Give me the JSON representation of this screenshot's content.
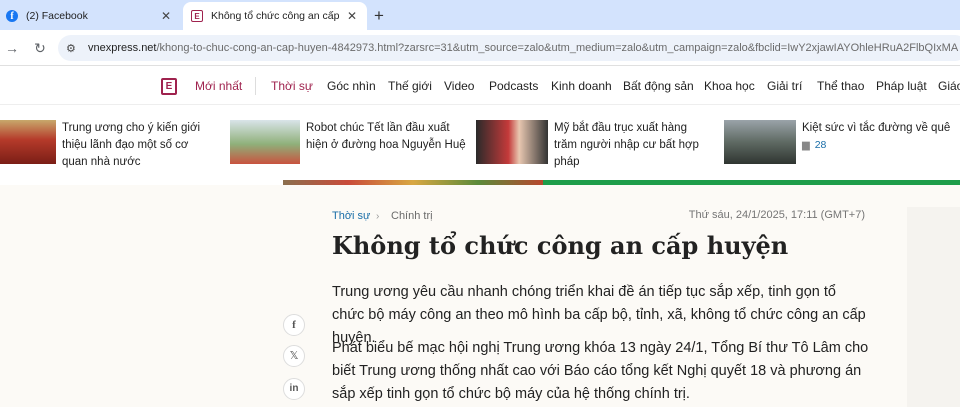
{
  "browser": {
    "tabs": [
      {
        "title": "(2) Facebook",
        "icon": "facebook-icon"
      },
      {
        "title": "Không tổ chức công an cấp huyện",
        "icon": "vnexpress-icon"
      }
    ],
    "url_host": "vnexpress.net",
    "url_rest": "/khong-to-chuc-cong-an-cap-huyen-4842973.html?zarsrc=31&utm_source=zalo&utm_medium=zalo&utm_campaign=zalo&fbclid=IwY2xjawIAYOhleHRuA2FlbQIxMA"
  },
  "nav": {
    "items": [
      "Mới nhất",
      "Thời sự",
      "Góc nhìn",
      "Thế giới",
      "Video",
      "Podcasts",
      "Kinh doanh",
      "Bất động sản",
      "Khoa học",
      "Giải trí",
      "Thể thao",
      "Pháp luật",
      "Giáo"
    ]
  },
  "featured": [
    {
      "text": "Trung ương cho ý kiến giới thiệu lãnh đạo một số cơ quan nhà nước"
    },
    {
      "text": "Robot chúc Tết lần đầu xuất hiện ở đường hoa Nguyễn Huệ"
    },
    {
      "text": "Mỹ bắt đầu trục xuất hàng trăm người nhập cư bất hợp pháp"
    },
    {
      "text": "Kiệt sức vì tắc đường về quê",
      "comments": "28"
    }
  ],
  "article": {
    "category": "Thời sự",
    "subcategory": "Chính trị",
    "datetime": "Thứ sáu, 24/1/2025, 17:11 (GMT+7)",
    "title": "Không tổ chức công an cấp huyện",
    "lead": "Trung ương yêu cầu nhanh chóng triển khai đề án tiếp tục sắp xếp, tinh gọn tổ chức bộ máy công an theo mô hình ba cấp bộ, tỉnh, xã, không tổ chức công an cấp huyện.",
    "body": "Phát biểu bế mạc hội nghị Trung ương khóa 13 ngày 24/1, Tổng Bí thư Tô Lâm cho biết Trung ương thống nhất cao với Báo cáo tổng kết Nghị quyết 18 và phương án sắp xếp tinh gọn tổ chức bộ máy của hệ thống chính trị."
  }
}
